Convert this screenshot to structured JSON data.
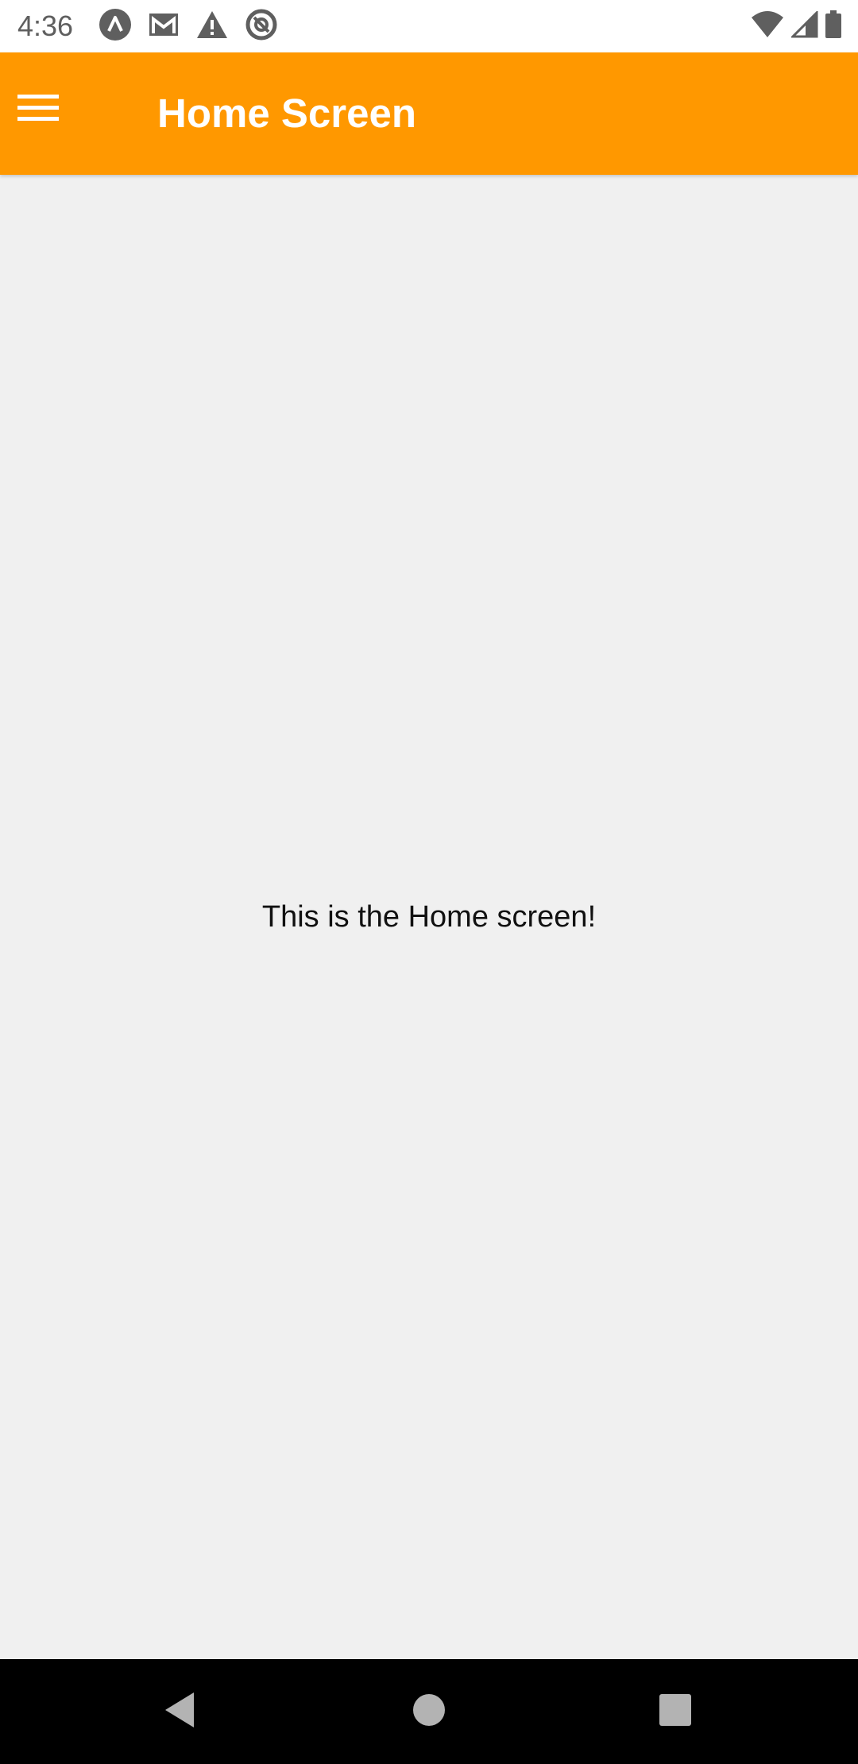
{
  "status_bar": {
    "time": "4:36",
    "left_icons": [
      "assistant-icon",
      "gmail-icon",
      "warning-icon",
      "at-sign-icon"
    ],
    "right_icons": [
      "wifi-icon",
      "cellular-signal-icon",
      "battery-icon"
    ]
  },
  "app_bar": {
    "title": "Home Screen",
    "menu_icon": "hamburger-menu-icon",
    "background_color": "#ff9800"
  },
  "main": {
    "message": "This is the Home screen!"
  },
  "nav_bar": {
    "buttons": [
      "back-icon",
      "home-icon",
      "recents-icon"
    ]
  }
}
